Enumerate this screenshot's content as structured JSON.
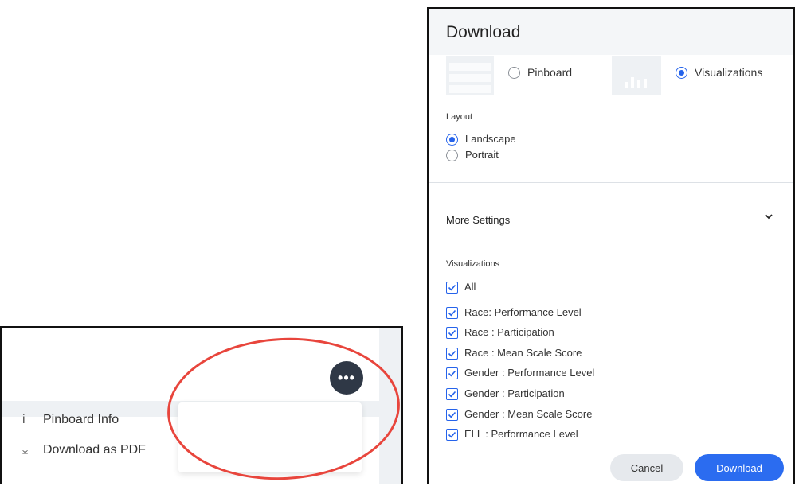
{
  "menu": {
    "more_icon": "more-horizontal-icon",
    "items": [
      {
        "icon": "info-icon",
        "glyph": "i",
        "label": "Pinboard Info"
      },
      {
        "icon": "download-icon",
        "glyph": "⤓",
        "label": "Download as PDF"
      }
    ],
    "highlight_color": "#e8453c"
  },
  "dialog": {
    "title": "Download",
    "type_options": [
      {
        "label": "Pinboard",
        "selected": false
      },
      {
        "label": "Visualizations",
        "selected": true
      }
    ],
    "layout_label": "Layout",
    "layout_options": [
      {
        "label": "Landscape",
        "selected": true
      },
      {
        "label": "Portrait",
        "selected": false
      }
    ],
    "more_settings": "More Settings",
    "visualizations_label": "Visualizations",
    "checkboxes": [
      {
        "label": "All",
        "checked": true
      },
      {
        "label": "Race: Performance Level",
        "checked": true
      },
      {
        "label": "Race : Participation",
        "checked": true
      },
      {
        "label": "Race : Mean Scale Score",
        "checked": true
      },
      {
        "label": "Gender : Performance Level",
        "checked": true
      },
      {
        "label": "Gender : Participation",
        "checked": true
      },
      {
        "label": "Gender : Mean Scale Score",
        "checked": true
      },
      {
        "label": "ELL : Performance Level",
        "checked": true
      }
    ],
    "cancel_label": "Cancel",
    "download_label": "Download",
    "accent_color": "#2563eb"
  }
}
